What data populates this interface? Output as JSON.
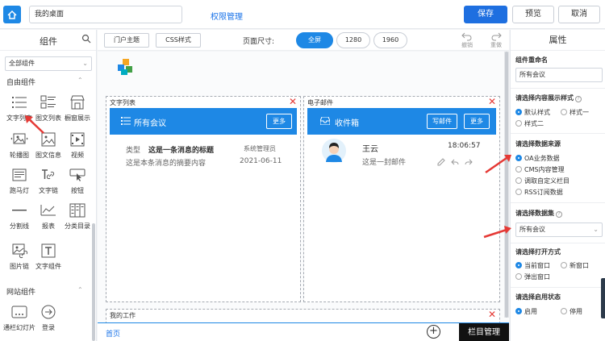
{
  "topbar": {
    "title_value": "我的桌面",
    "permission_link": "权限管理",
    "save_label": "保存",
    "preview_label": "预览",
    "cancel_label": "取消"
  },
  "left_panel": {
    "title": "组件",
    "category_select": "全部组件",
    "section_free": "自由组件",
    "section_site": "网站组件",
    "components": [
      {
        "label": "文字列表",
        "icon": "text-list-icon"
      },
      {
        "label": "图文列表",
        "icon": "image-text-list-icon"
      },
      {
        "label": "橱窗展示",
        "icon": "showcase-icon"
      },
      {
        "label": "轮播图",
        "icon": "carousel-icon"
      },
      {
        "label": "图文信息",
        "icon": "image-info-icon"
      },
      {
        "label": "视频",
        "icon": "video-icon"
      },
      {
        "label": "跑马灯",
        "icon": "marquee-icon"
      },
      {
        "label": "文字链",
        "icon": "text-link-icon"
      },
      {
        "label": "按钮",
        "icon": "button-icon"
      },
      {
        "label": "分割线",
        "icon": "divider-icon"
      },
      {
        "label": "报表",
        "icon": "report-icon"
      },
      {
        "label": "分类目录",
        "icon": "category-icon"
      },
      {
        "label": "图片链",
        "icon": "image-link-icon"
      },
      {
        "label": "文字组件",
        "icon": "text-component-icon"
      }
    ],
    "site_components": [
      {
        "label": "通栏幻灯片",
        "icon": "banner-slide-icon"
      },
      {
        "label": "登录",
        "icon": "login-icon"
      }
    ]
  },
  "center": {
    "portal_theme_btn": "门户主题",
    "css_btn": "CSS样式",
    "page_size_label": "页面尺寸:",
    "size_options": [
      "全屏",
      "1280",
      "1960"
    ],
    "active_size": "全屏",
    "undo_label": "撤销",
    "redo_label": "重做",
    "text_list_widget": {
      "title": "文字列表",
      "header": "所有会议",
      "more": "更多",
      "type_label": "类型",
      "item_title": "这是一条消息的标题",
      "item_author": "系统管理员",
      "item_summary": "这是本条消息的摘要内容",
      "item_date": "2021-06-11"
    },
    "mail_widget": {
      "title": "电子邮件",
      "header": "收件箱",
      "write_btn": "写邮件",
      "more": "更多",
      "sender": "王云",
      "time": "18:06:57",
      "content": "这是一封邮件"
    },
    "my_work_title": "我的工作",
    "home_tab": "首页",
    "column_manage": "栏目管理"
  },
  "right_panel": {
    "title": "属性",
    "rename_label": "组件重命名",
    "rename_value": "所有会议",
    "style_label": "请选择内容展示样式",
    "style_options": [
      "默认样式",
      "样式一",
      "样式二"
    ],
    "style_selected": "默认样式",
    "source_label": "请选择数据来源",
    "source_options": [
      "OA业务数据",
      "CMS内容管理",
      "调取自定义栏目",
      "RSS订阅数据"
    ],
    "source_selected": "OA业务数据",
    "dataset_label": "请选择数据集",
    "dataset_value": "所有会议",
    "open_label": "请选择打开方式",
    "open_options": [
      "当前窗口",
      "新窗口",
      "弹出窗口"
    ],
    "open_selected": "当前窗口",
    "enable_label": "请选择启用状态",
    "enable_options": [
      "启用",
      "停用"
    ],
    "enable_selected": "启用"
  },
  "colors": {
    "primary": "#1e88e5",
    "save": "#1e6fe0",
    "close_red": "#e53935",
    "annotation_arrow": "#e53935"
  }
}
